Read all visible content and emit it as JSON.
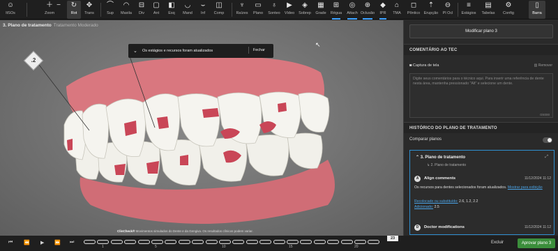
{
  "toolbar": {
    "items": [
      {
        "id": "sit",
        "label": "ItSOs",
        "icon": "person-icon"
      },
      {
        "id": "zoom",
        "label": "Zoom",
        "icon": "zoom-icon"
      },
      {
        "id": "rot",
        "label": "Rot",
        "icon": "rotate-icon"
      },
      {
        "id": "trans",
        "label": "Trans",
        "icon": "move-icon"
      },
      {
        "id": "sup",
        "label": "Sup",
        "icon": "upper-jaw-icon"
      },
      {
        "id": "maxilla",
        "label": "Maxila",
        "icon": "maxilla-icon"
      },
      {
        "id": "div",
        "label": "Div",
        "icon": "divide-icon"
      },
      {
        "id": "ant",
        "label": "Ant",
        "icon": "front-view-icon"
      },
      {
        "id": "esq",
        "label": "Esq",
        "icon": "left-view-icon"
      },
      {
        "id": "mand",
        "label": "Mand",
        "icon": "mandible-icon"
      },
      {
        "id": "inf",
        "label": "Inf",
        "icon": "lower-jaw-icon"
      },
      {
        "id": "comp",
        "label": "Comp",
        "icon": "compare-icon"
      },
      {
        "id": "raizes",
        "label": "Raízes",
        "icon": "roots-icon"
      },
      {
        "id": "plano",
        "label": "Plano",
        "icon": "plane-icon"
      },
      {
        "id": "sonteo",
        "label": "Sonteo",
        "icon": "tooth-icon"
      },
      {
        "id": "video",
        "label": "Vídeo",
        "icon": "video-icon"
      },
      {
        "id": "sobrep",
        "label": "Sobrep",
        "icon": "overlay-icon"
      },
      {
        "id": "grade",
        "label": "Grade",
        "icon": "grid-icon"
      },
      {
        "id": "regua",
        "label": "Régua",
        "icon": "ruler-icon"
      },
      {
        "id": "attach",
        "label": "Attach",
        "icon": "attachment-icon"
      },
      {
        "id": "oclusao",
        "label": "Oclusão",
        "icon": "occlusion-icon"
      },
      {
        "id": "ipr",
        "label": "IPR",
        "icon": "ipr-icon"
      },
      {
        "id": "tma",
        "label": "TMA",
        "icon": "tma-icon"
      },
      {
        "id": "pontos",
        "label": "Pôntico",
        "icon": "pontic-icon"
      },
      {
        "id": "erupcao",
        "label": "Erupção",
        "icon": "eruption-icon"
      },
      {
        "id": "plocl",
        "label": "Pl Ocl",
        "icon": "occlusal-plane-icon"
      },
      {
        "id": "estagios",
        "label": "Estágios",
        "icon": "stages-icon"
      },
      {
        "id": "tabelas",
        "label": "Tabelas",
        "icon": "table-icon"
      },
      {
        "id": "config",
        "label": "Config",
        "icon": "gear-icon"
      },
      {
        "id": "barra",
        "label": "Barra",
        "icon": "sidebar-icon"
      }
    ]
  },
  "viewport": {
    "title": "3. Plano de tratamento",
    "subtitle": "Tratamento Moderado",
    "marker_label": ".2",
    "toast_message": "Os estágios e recursos foram atualizados",
    "toast_close": "Fechar",
    "disclaimer_brand": "ClinCheck®",
    "disclaimer_text": "Movimentos simulados do Dente e da Gengiva. Os resultados clínicos podem variar."
  },
  "timeline": {
    "ticks": [
      "1",
      "5",
      "10",
      "15",
      "20"
    ],
    "end_stage": "23",
    "segment_count": 23
  },
  "panel": {
    "modify_button": "Modificar plano 3",
    "comment_header": "COMENTÁRIO AO TEC",
    "capture_label": "Captura de tela",
    "remove_label": "Remover",
    "comment_placeholder": "Digite seus comentários para o técnico aqui. Para inserir uma referência de dente nesta área, mantenha pressionado \"Alt\" e selecione um dente.",
    "char_count": "0/4000",
    "history_header": "HISTÓRICO DO PLANO DE TRATAMENTO",
    "compare_label": "Comparar planos",
    "plan_title": "3. Plano de tratamento",
    "plan_sub": "2. Plano de tratamento",
    "entries": [
      {
        "avatar": "A",
        "name": "Align comments",
        "date": "11/12/2024 11:12",
        "text": "Os recursos para dentes selecionados foram atualizados.",
        "link": "Mostrar para exibição",
        "kv1_key": "Recolocado ou substituído:",
        "kv1_val": "2.6, 1.2, 2.2",
        "kv2_key": "Adicionado:",
        "kv2_val": "2.5"
      },
      {
        "avatar": "D",
        "name": "Doctor modifications",
        "date": "11/12/2024 11:12"
      }
    ]
  },
  "footer": {
    "exclude": "Excluir",
    "approve": "Aprovar plano 3"
  },
  "colors": {
    "accent": "#3aa0ff",
    "approve": "#3b8e3b",
    "gum": "#d9777f",
    "attachment": "#c94657"
  }
}
